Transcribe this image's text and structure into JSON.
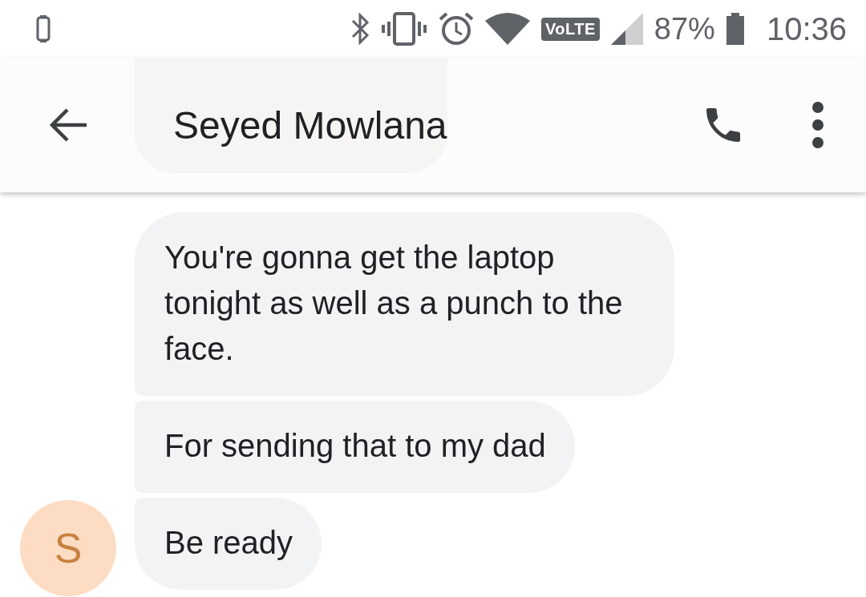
{
  "status_bar": {
    "network": "VoLTE",
    "battery": "87%",
    "time": "10:36"
  },
  "header": {
    "title": "Seyed Mowlana"
  },
  "conversation": {
    "avatar": "S",
    "messages": [
      {
        "text": "You're gonna get the laptop tonight as well as a punch to the face."
      },
      {
        "text": "For sending that to my dad"
      },
      {
        "text": "Be ready"
      }
    ]
  }
}
